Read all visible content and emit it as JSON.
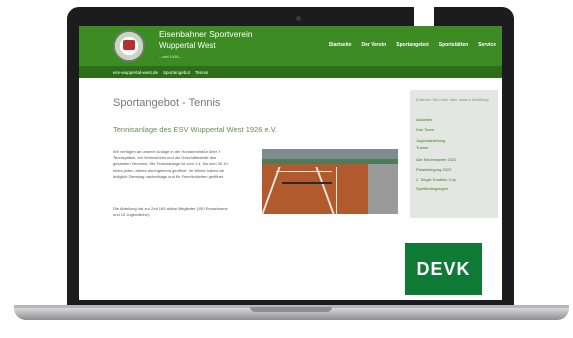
{
  "club": {
    "name": "Eisenbahner Sportverein",
    "location": "Wuppertal West",
    "since": "– seit 1926 –"
  },
  "nav": [
    "Startseite",
    "Der Verein",
    "Sportangebot",
    "Sportstätten",
    "Service"
  ],
  "breadcrumb": [
    "esv-wuppertal-west.de",
    "Sportangebot",
    "Tennis"
  ],
  "page": {
    "title": "Sportangebot - Tennis",
    "subtitle": "Tennisanlage des ESV Wuppertal West 1926 e.V.",
    "paragraph1": "Wir verfügen an unserer Anlage in der Homannstraße über 7 Tennisplätze, ein Vereinsheim und die Geschäftsstelle des gesamten Vereines. Die Tennisanlage ist vom 1.4. bis zum 30.10. eines jeden Jahres durchgehend geöffnet. Im Winter haben wir lediglich Dienstag nachmittags und für Feierlichkeiten geöffnet.",
    "paragraph2": "Die Abteilung hat zur Zeit 165 aktive Mitglieder (150 Erwachsene und 15 Jugendliche)."
  },
  "sidebar": {
    "intro": "Erfahren Sie mehr über unsere Abteilung:",
    "items": [
      "Aktuelles",
      "Das Team",
      "Jugendabteilung",
      "Trainer",
      "Alle Medenspiele 2022",
      "Platzbelegung 2022",
      "2. Single Doubles Cup",
      "Spielbedingungen"
    ]
  },
  "sponsor": {
    "label": "DEVK"
  }
}
